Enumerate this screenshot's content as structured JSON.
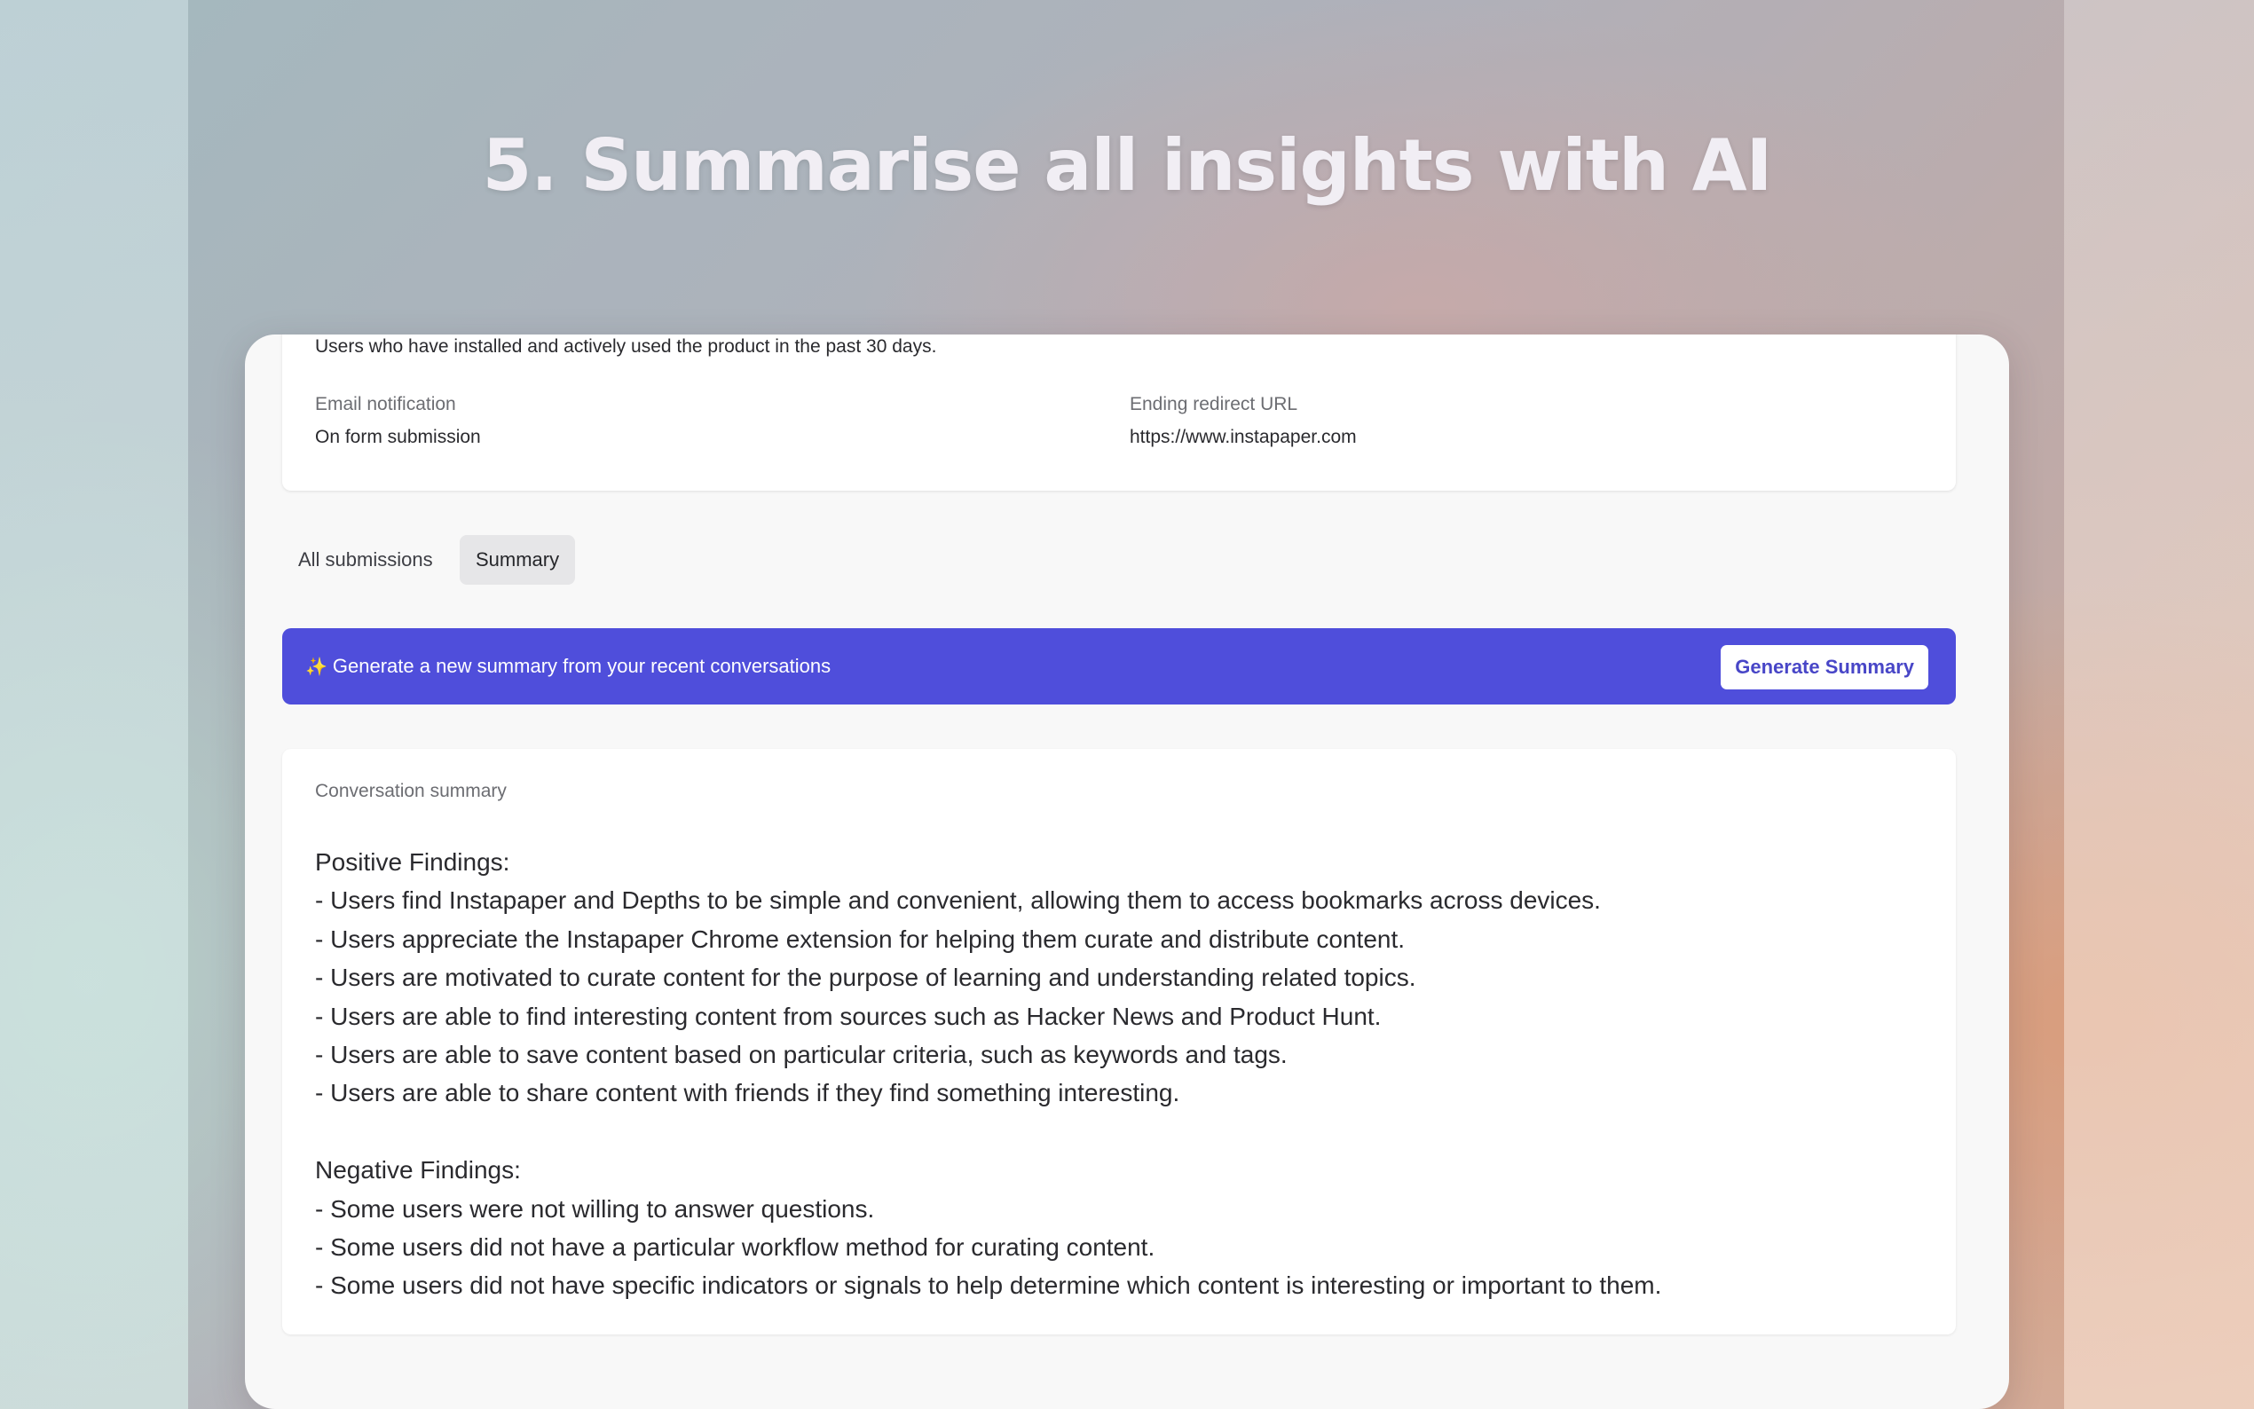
{
  "headline": "5. Summarise all insights with AI",
  "info_card": {
    "description": "Users who have installed and actively used the product in the past 30 days.",
    "email_notification": {
      "label": "Email notification",
      "value": "On form submission"
    },
    "ending_redirect": {
      "label": "Ending redirect URL",
      "value": "https://www.instapaper.com"
    }
  },
  "tabs": [
    {
      "label": "All submissions",
      "active": false
    },
    {
      "label": "Summary",
      "active": true
    }
  ],
  "banner": {
    "icon": "sparkle-icon",
    "text": "Generate a new summary from your recent conversations",
    "button_label": "Generate Summary",
    "color": "#4f4edb"
  },
  "summary": {
    "title": "Conversation summary",
    "positive_heading": "Positive Findings:",
    "positive": [
      "- Users find Instapaper and Depths to be simple and convenient, allowing them to access bookmarks across devices.",
      "- Users appreciate the Instapaper Chrome extension for helping them curate and distribute content.",
      "- Users are motivated to curate content for the purpose of learning and understanding related topics.",
      "- Users are able to find interesting content from sources such as Hacker News and Product Hunt.",
      "- Users are able to save content based on particular criteria, such as keywords and tags.",
      "- Users are able to share content with friends if they find something interesting."
    ],
    "negative_heading": "Negative Findings:",
    "negative": [
      "- Some users were not willing to answer questions.",
      "- Some users did not have a particular workflow method for curating content.",
      "- Some users did not have specific indicators or signals to help determine which content is interesting or important to them."
    ]
  }
}
